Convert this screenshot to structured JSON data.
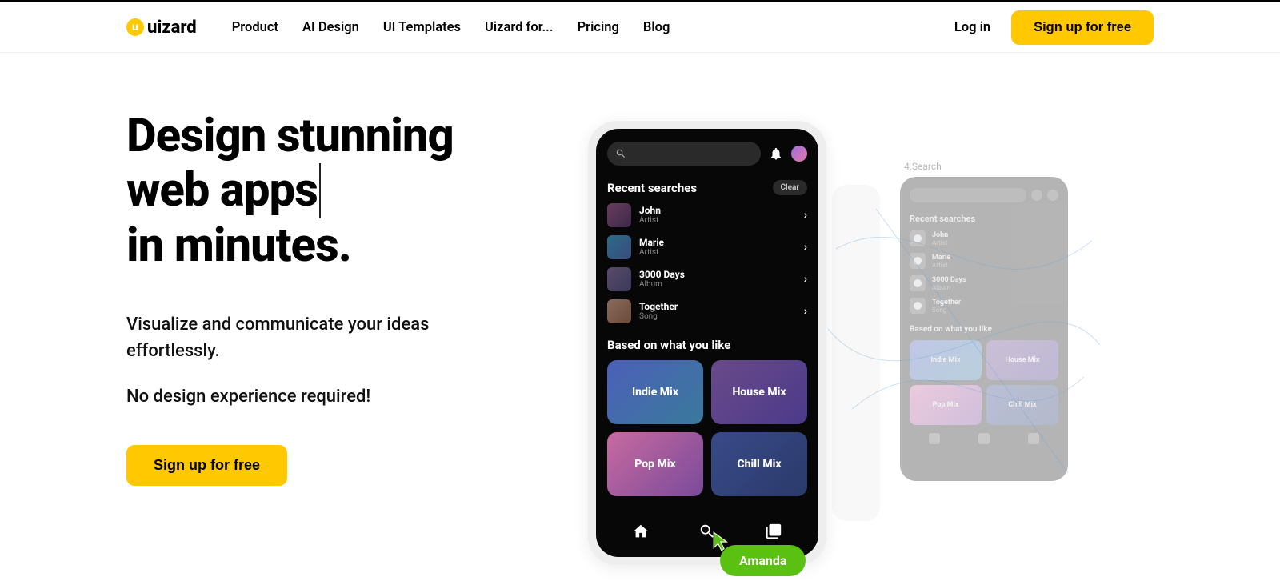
{
  "brand": "uizard",
  "nav": {
    "items": [
      "Product",
      "AI Design",
      "UI Templates",
      "Uizard for...",
      "Pricing",
      "Blog"
    ]
  },
  "header": {
    "login": "Log in",
    "signup": "Sign up for free"
  },
  "hero": {
    "line1": "Design stunning",
    "line2": "web apps",
    "line3": "in minutes.",
    "sub1a": "Visualize and communicate your ideas",
    "sub1b": "effortlessly.",
    "sub2": "No design experience required!",
    "cta": "Sign up for free"
  },
  "phone": {
    "recent_title": "Recent searches",
    "clear": "Clear",
    "searches": [
      {
        "name": "John",
        "sub": "Artist"
      },
      {
        "name": "Marie",
        "sub": "Artist"
      },
      {
        "name": "3000 Days",
        "sub": "Album"
      },
      {
        "name": "Together",
        "sub": "Song"
      }
    ],
    "based_title": "Based on what you like",
    "cards": [
      "Indie Mix",
      "House Mix",
      "Pop Mix",
      "Chill Mix"
    ]
  },
  "ghost_label": "4.Search",
  "collaborator": "Amanda"
}
